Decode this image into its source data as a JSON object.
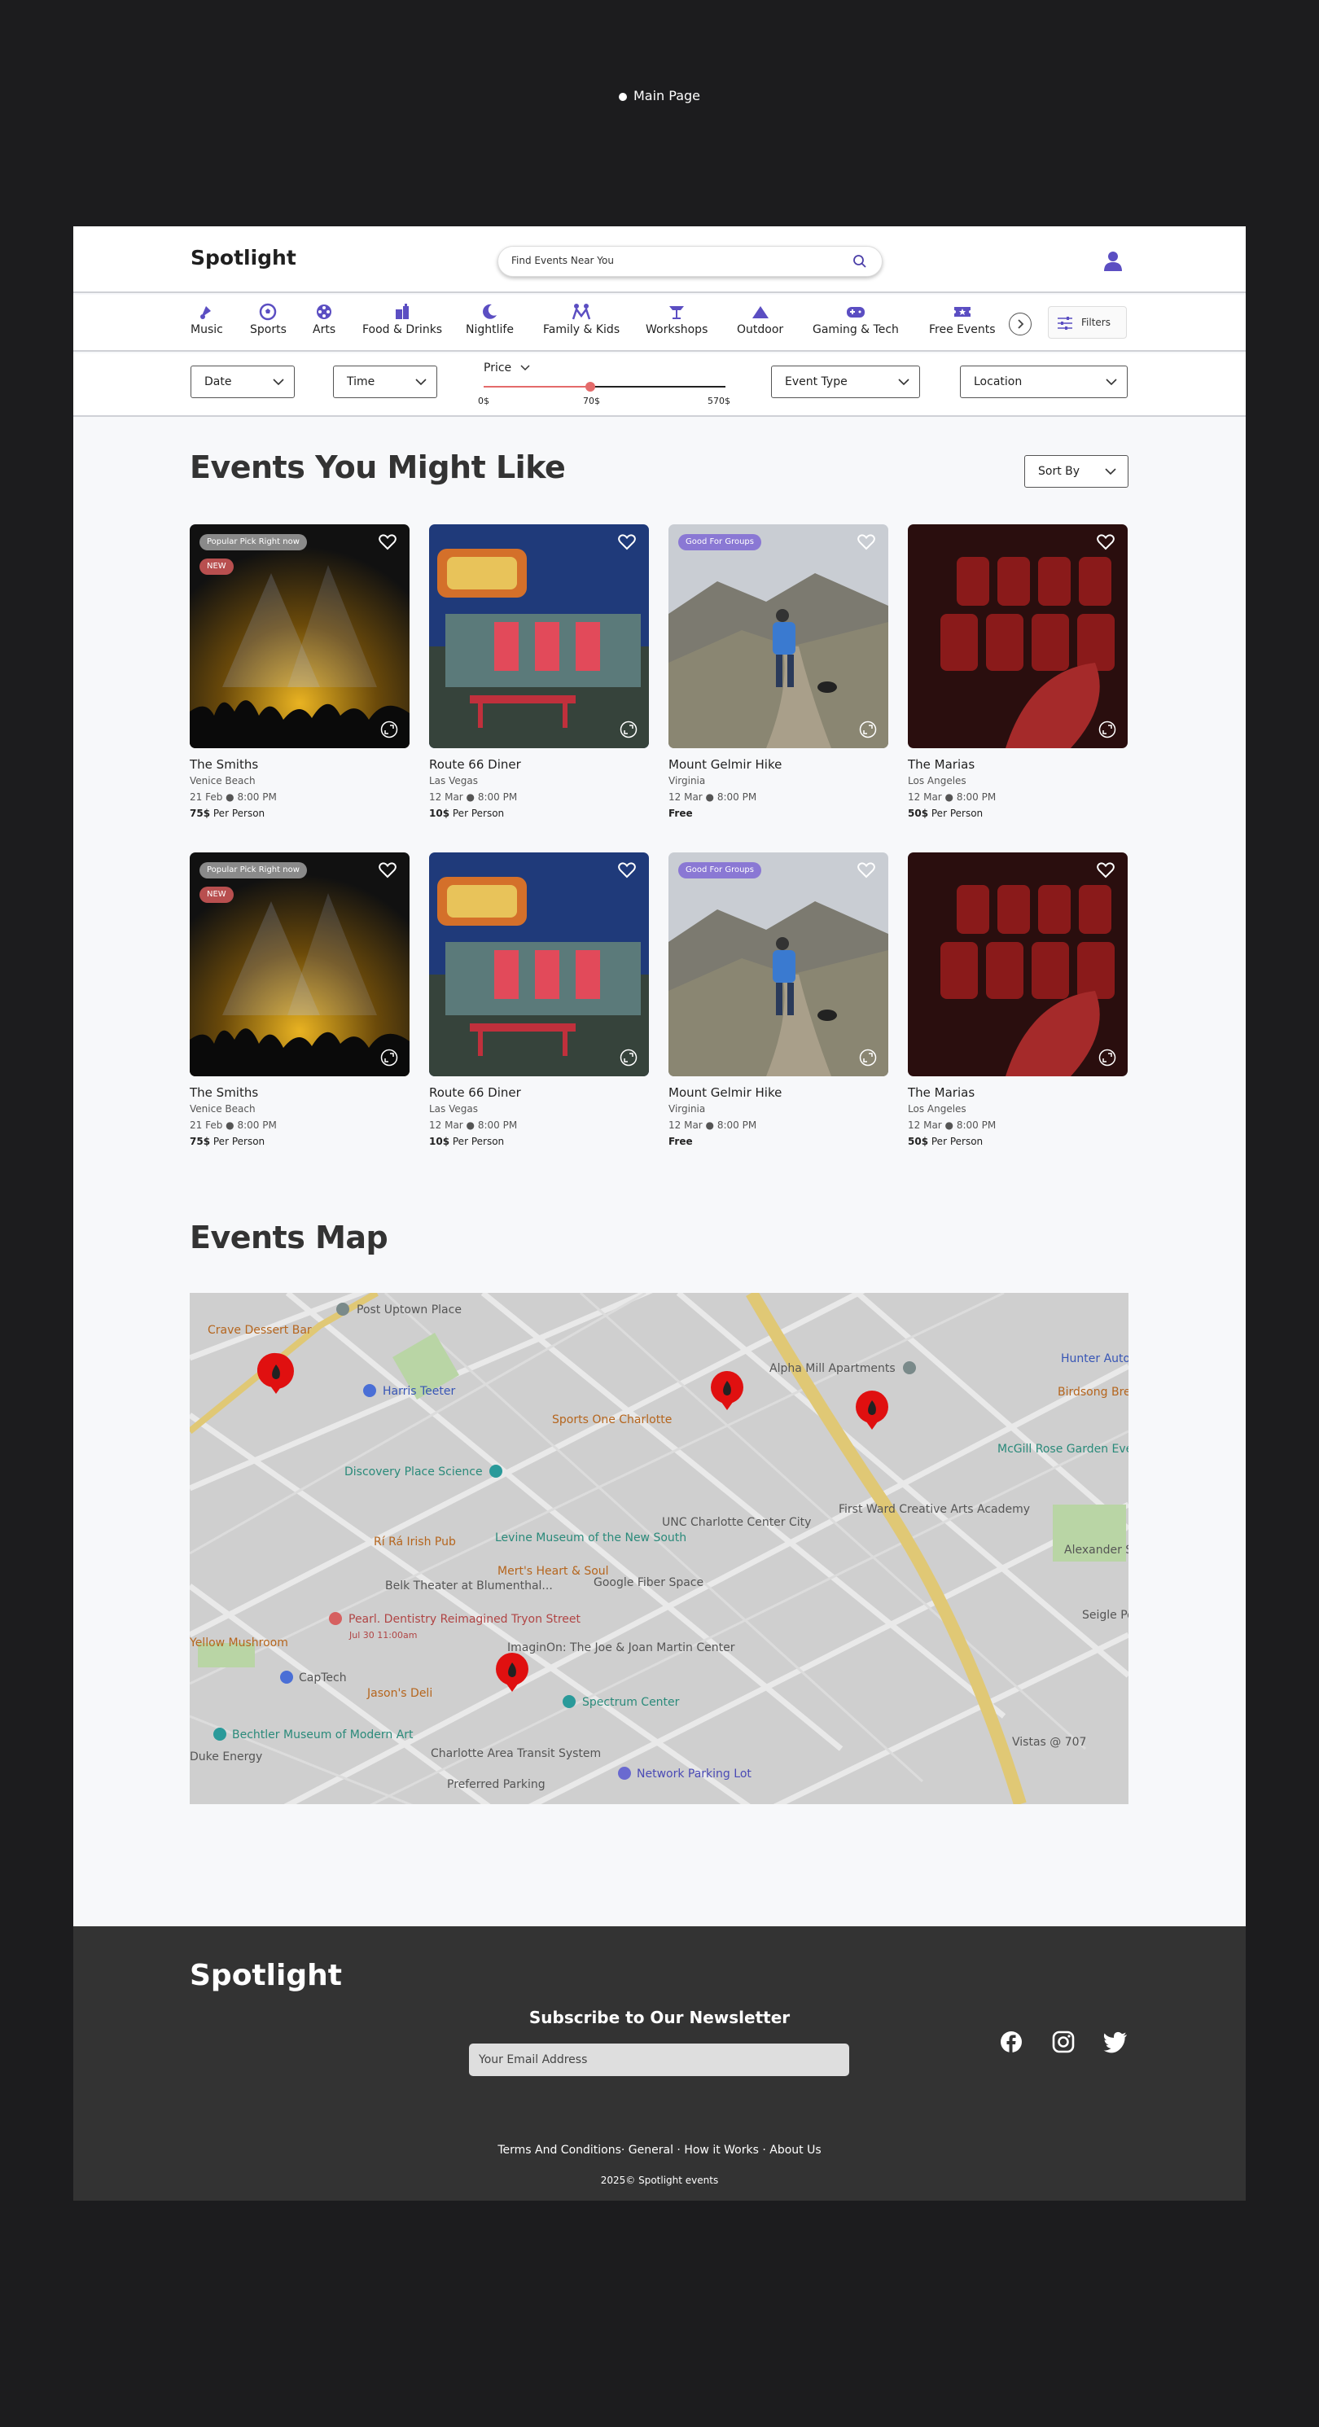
{
  "page_label": "Main Page",
  "header": {
    "logo": "Spotlight",
    "search_placeholder": "Find Events Near You"
  },
  "categories": [
    {
      "label": "Music",
      "icon": "music-icon"
    },
    {
      "label": "Sports",
      "icon": "soccer-ball-icon"
    },
    {
      "label": "Arts",
      "icon": "film-reel-icon"
    },
    {
      "label": "Food & Drinks",
      "icon": "food-icon"
    },
    {
      "label": "Nightlife",
      "icon": "moon-icon"
    },
    {
      "label": "Family & Kids",
      "icon": "family-icon"
    },
    {
      "label": "Workshops",
      "icon": "workshop-icon"
    },
    {
      "label": "Outdoor",
      "icon": "mountain-icon"
    },
    {
      "label": "Gaming & Tech",
      "icon": "gamepad-icon"
    },
    {
      "label": "Free Events",
      "icon": "ticket-icon"
    }
  ],
  "filters_button": "Filters",
  "filter_bar": {
    "date": "Date",
    "time": "Time",
    "price_label": "Price",
    "price_min": "0$",
    "price_mid": "70$",
    "price_max": "570$",
    "price_selected_fraction": 0.44,
    "event_type": "Event Type",
    "location": "Location"
  },
  "events_section": {
    "title": "Events You Might Like",
    "sort_label": "Sort By"
  },
  "events": [
    {
      "title": "The Smiths",
      "location": "Venice Beach",
      "date": "21 Feb",
      "time": "8:00 PM",
      "price": "75$",
      "price_suffix": " Per Person",
      "badge": "Popular Pick Right now",
      "new_badge": "NEW"
    },
    {
      "title": "Route 66 Diner",
      "location": "Las Vegas",
      "date": "12 Mar",
      "time": "8:00 PM",
      "price": "10$",
      "price_suffix": " Per Person",
      "badge": "",
      "new_badge": ""
    },
    {
      "title": "Mount Gelmir Hike",
      "location": "Virginia",
      "date": "12 Mar",
      "time": "8:00 PM",
      "price": "Free",
      "price_suffix": "",
      "badge": "Good For Groups",
      "new_badge": ""
    },
    {
      "title": "The Marias",
      "location": "Los Angeles",
      "date": "12 Mar",
      "time": "8:00 PM",
      "price": "50$",
      "price_suffix": " Per Person",
      "badge": "",
      "new_badge": ""
    },
    {
      "title": "The Smiths",
      "location": "Venice Beach",
      "date": "21 Feb",
      "time": "8:00 PM",
      "price": "75$",
      "price_suffix": " Per Person",
      "badge": "Popular Pick Right now",
      "new_badge": "NEW"
    },
    {
      "title": "Route 66 Diner",
      "location": "Las Vegas",
      "date": "12 Mar",
      "time": "8:00 PM",
      "price": "10$",
      "price_suffix": " Per Person",
      "badge": "",
      "new_badge": ""
    },
    {
      "title": "Mount Gelmir Hike",
      "location": "Virginia",
      "date": "12 Mar",
      "time": "8:00 PM",
      "price": "Free",
      "price_suffix": "",
      "badge": "Good For Groups",
      "new_badge": ""
    },
    {
      "title": "The Marias",
      "location": "Los Angeles",
      "date": "12 Mar",
      "time": "8:00 PM",
      "price": "50$",
      "price_suffix": " Per Person",
      "badge": "",
      "new_badge": ""
    }
  ],
  "map_section": {
    "title": "Events Map",
    "labels": [
      "Post Uptown Place",
      "Crave Dessert Bar",
      "Harris Teeter",
      "Sports One Charlotte",
      "Alpha Mill Apartments",
      "Hunter Auto Wrecker Serv",
      "Birdsong Brewing C",
      "McGill Rose Garden Events",
      "Discovery Place Science",
      "UNC Charlotte Center City",
      "First Ward Creative Arts Academy",
      "Rí Rá Irish Pub",
      "Levine Museum of the New South",
      "Mert's Heart & Soul",
      "Belk Theater at Blumenthal...",
      "Google Fiber Space",
      "Pearl. Dentistry Reimagined Tryon Street",
      "Jul 30 11:00am",
      "Yellow Mushroom",
      "CapTech",
      "ImaginOn: The Joe & Joan Martin Center",
      "Jason's Deli",
      "Spectrum Center",
      "Bechtler Museum of Modern Art",
      "Charlotte Area Transit System",
      "Preferred Parking",
      "Network Parking Lot",
      "Alexander Street Park",
      "Seigle Po Apartment Hon",
      "Vistas @ 707",
      "Duke Energy"
    ]
  },
  "footer": {
    "logo": "Spotlight",
    "newsletter_title": "Subscribe to Our Newsletter",
    "email_placeholder": "Your Email Address",
    "links": "Terms And Conditions· General · How it Works · About Us",
    "copyright": "2025© Spotlight events"
  },
  "colors": {
    "accent": "#6a5acd",
    "new_badge": "#b84f4f",
    "price_track": "#e46b6b",
    "footer_bg": "#333333"
  }
}
